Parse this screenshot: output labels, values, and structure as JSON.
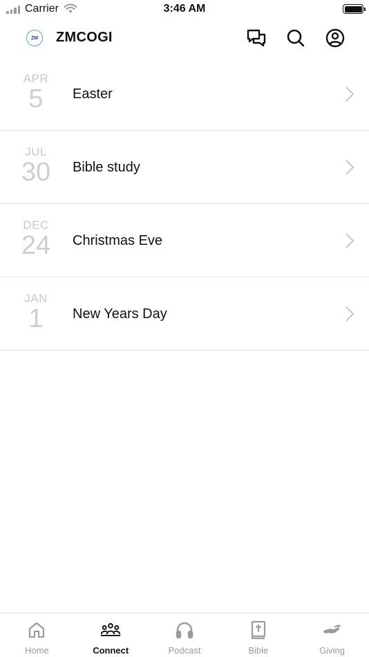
{
  "status_bar": {
    "carrier": "Carrier",
    "time": "3:46 AM"
  },
  "header": {
    "logo_text": "ZM",
    "title": "ZMCOGI",
    "icons": [
      "chat-bubbles-icon",
      "search-icon",
      "account-icon"
    ]
  },
  "events": [
    {
      "month": "APR",
      "day": "5",
      "title": "Easter"
    },
    {
      "month": "JUL",
      "day": "30",
      "title": "Bible study"
    },
    {
      "month": "DEC",
      "day": "24",
      "title": "Christmas Eve"
    },
    {
      "month": "JAN",
      "day": "1",
      "title": "New Years Day"
    }
  ],
  "tabs": [
    {
      "label": "Home",
      "icon": "home-icon",
      "active": false
    },
    {
      "label": "Connect",
      "icon": "people-icon",
      "active": true
    },
    {
      "label": "Podcast",
      "icon": "headphones-icon",
      "active": false
    },
    {
      "label": "Bible",
      "icon": "bible-icon",
      "active": false
    },
    {
      "label": "Giving",
      "icon": "giving-hand-icon",
      "active": false
    }
  ],
  "colors": {
    "active_tab": "#111111",
    "inactive_tab": "#9a9a9a",
    "date_text": "#cccccc",
    "divider": "#e6e6e6"
  }
}
